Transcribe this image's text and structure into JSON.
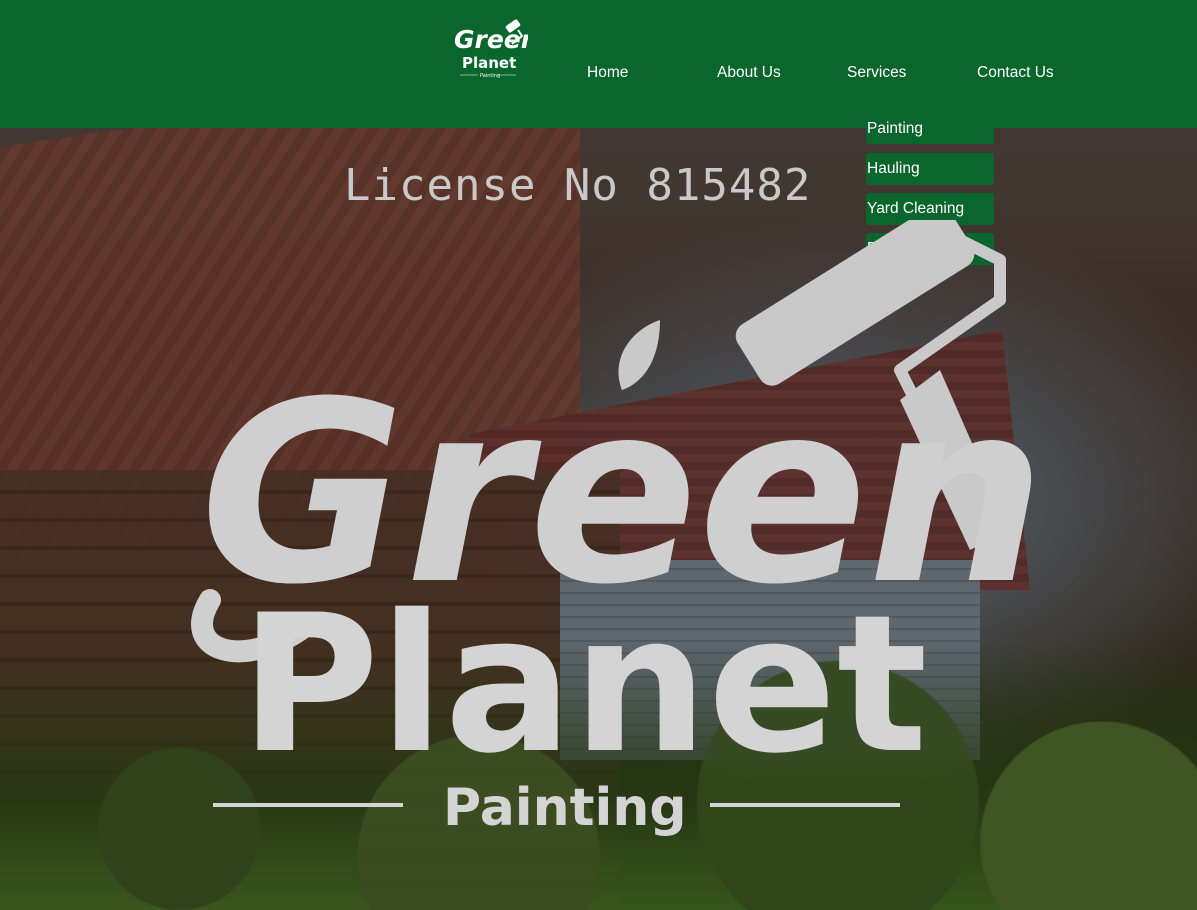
{
  "nav": {
    "logo": {
      "script": "Green",
      "word": "Planet",
      "tag": "Painting"
    },
    "links": [
      {
        "label": "Home"
      },
      {
        "label": "About Us"
      },
      {
        "label": "Services"
      },
      {
        "label": "Contact Us"
      }
    ]
  },
  "services_menu": {
    "items": [
      {
        "label": "Painting"
      },
      {
        "label": "Hauling"
      },
      {
        "label": "Yard Cleaning"
      },
      {
        "label": "Demolition"
      }
    ]
  },
  "hero": {
    "license": "License No 815482",
    "logo": {
      "script": "Green",
      "word": "Planet",
      "tag": "Painting"
    }
  },
  "colors": {
    "brand_green": "#0b662d",
    "text_white": "#ffffff",
    "logo_gray": "#d0d0d0"
  }
}
